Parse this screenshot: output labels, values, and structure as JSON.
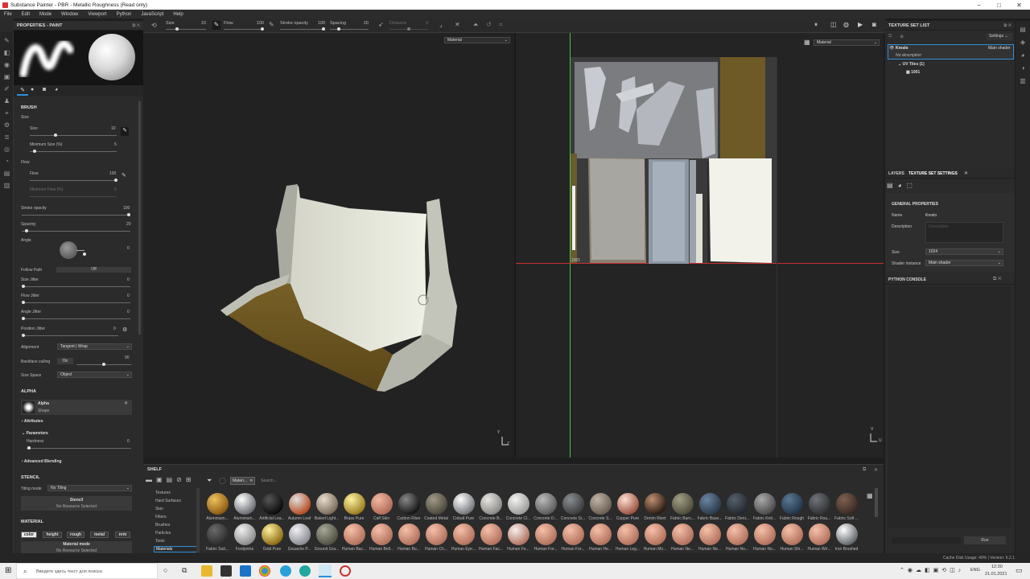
{
  "window": {
    "title": "Substance Painter - PBR - Metallic Roughness (Read only)",
    "controls": [
      "−",
      "□",
      "✕"
    ]
  },
  "menu": [
    "File",
    "Edit",
    "Mode",
    "Window",
    "Viewport",
    "Python",
    "JavaScript",
    "Help"
  ],
  "toolbar": {
    "size": {
      "label": "Size",
      "value": "10",
      "fraction": 0.25
    },
    "flow": {
      "label": "Flow",
      "value": "100",
      "fraction": 1.0
    },
    "stroke_opacity": {
      "label": "Stroke opacity",
      "value": "100",
      "fraction": 1.0
    },
    "spacing": {
      "label": "Spacing",
      "value": "20",
      "fraction": 0.2
    },
    "distance": {
      "label": "Distance",
      "value": "0"
    },
    "view_mode_3d": "Material",
    "view_mode_2d": "Material"
  },
  "properties": {
    "title": "PROPERTIES - PAINT",
    "brush_section": "BRUSH",
    "size_group": "Size",
    "size_label": "Size",
    "size_value": "10",
    "min_size_label": "Minimum Size (%)",
    "min_size_value": "5",
    "flow_group": "Flow",
    "flow_label": "Flow",
    "flow_value": "100",
    "min_flow_label": "Minimum Flow (%)",
    "min_flow_value": "5",
    "stroke_opacity_label": "Stroke opacity",
    "stroke_opacity_value": "100",
    "spacing_label": "Spacing",
    "spacing_value": "20",
    "angle_label": "Angle",
    "angle_value": "0",
    "follow_path_label": "Follow Path",
    "follow_path_value": "Off",
    "size_jitter_label": "Size Jitter",
    "size_jitter_value": "0",
    "flow_jitter_label": "Flow Jitter",
    "flow_jitter_value": "0",
    "angle_jitter_label": "Angle Jitter",
    "angle_jitter_value": "0",
    "position_jitter_label": "Position Jitter",
    "position_jitter_value": "0",
    "alignment_label": "Alignment",
    "alignment_value": "Tangent | Wrap",
    "backface_label": "Backface culling",
    "backface_toggle": "On",
    "backface_value": "90",
    "size_space_label": "Size Space",
    "size_space_value": "Object",
    "alpha_section": "ALPHA",
    "alpha_name": "Alpha",
    "alpha_type": "Shape",
    "attributes_label": "Attributes",
    "parameters_label": "Parameters",
    "hardness_label": "Hardness",
    "hardness_value": "0",
    "advanced_label": "Advanced Blending",
    "stencil_section": "STENCIL",
    "tiling_label": "Tiling mode",
    "tiling_value": "No Tiling",
    "stencil_name": "Stencil",
    "stencil_res": "No Resource Selected",
    "material_section": "MATERIAL",
    "channels": [
      "color",
      "height",
      "rough",
      "metal",
      "nrm"
    ],
    "material_mode": "Material mode",
    "material_res": "No Resource Selected"
  },
  "viewport": {
    "uv_label_top_left": "1001",
    "uv_label_bottom_left": "1001",
    "axis_3d": [
      "Y",
      "Z"
    ],
    "axis_2d": [
      "V",
      "U"
    ]
  },
  "shelf": {
    "title": "SHELF",
    "filter_tag": "Materi...",
    "search_placeholder": "Search...",
    "categories": [
      "Textures",
      "Hard Surfaces",
      "Skin",
      "Filters",
      "Brushes",
      "Particles",
      "Tools",
      "Materials"
    ],
    "active_category": "Materials",
    "row1": [
      {
        "name": "Aluminium...",
        "c1": "#f0c060",
        "c2": "#8a5a10"
      },
      {
        "name": "Aluminium...",
        "c1": "#ffffff",
        "c2": "#666a70"
      },
      {
        "name": "Artificial Lea...",
        "c1": "#555555",
        "c2": "#0a0a0a"
      },
      {
        "name": "Autumn Leaf",
        "c1": "#e0e0e0",
        "c2": "#b84a20"
      },
      {
        "name": "Baked Light...",
        "c1": "#e8dccc",
        "c2": "#7a6a5a"
      },
      {
        "name": "Brass Pure",
        "c1": "#fff4a0",
        "c2": "#9a7a20"
      },
      {
        "name": "Calf Skin",
        "c1": "#f2b8a0",
        "c2": "#b06a58"
      },
      {
        "name": "Carbon Fiber",
        "c1": "#888888",
        "c2": "#141414"
      },
      {
        "name": "Coated Metal",
        "c1": "#a09a86",
        "c2": "#4a463a"
      },
      {
        "name": "Cobalt Pure",
        "c1": "#ffffff",
        "c2": "#707378"
      },
      {
        "name": "Concrete B...",
        "c1": "#e8e6e2",
        "c2": "#8a8884"
      },
      {
        "name": "Concrete Cl...",
        "c1": "#f4f4f2",
        "c2": "#9a9a98"
      },
      {
        "name": "Concrete D...",
        "c1": "#bbbbbb",
        "c2": "#5a5a5a"
      },
      {
        "name": "Concrete Si...",
        "c1": "#8a8e90",
        "c2": "#3a3c3e"
      },
      {
        "name": "Concrete S...",
        "c1": "#c0b4a8",
        "c2": "#6a5e54"
      },
      {
        "name": "Copper Pure",
        "c1": "#ffe0d0",
        "c2": "#9a5040"
      },
      {
        "name": "Denim Rivet",
        "c1": "#c09070",
        "c2": "#2a1a12"
      },
      {
        "name": "Fabric Barn...",
        "c1": "#a4a084",
        "c2": "#4c4a3a"
      },
      {
        "name": "Fabric Base...",
        "c1": "#6a86a0",
        "c2": "#2a3a4a"
      },
      {
        "name": "Fabric Deni...",
        "c1": "#56606a",
        "c2": "#22282e"
      },
      {
        "name": "Fabric Knit...",
        "c1": "#aaaaaa",
        "c2": "#4a4a4a"
      },
      {
        "name": "Fabric Rough",
        "c1": "#5a7896",
        "c2": "#223446"
      },
      {
        "name": "Fabric Rou...",
        "c1": "#707478",
        "c2": "#2e3034"
      },
      {
        "name": "Fabric Soft ...",
        "c1": "#806050",
        "c2": "#3a2a22"
      }
    ],
    "row2": [
      {
        "name": "Fabric Suit...",
        "c1": "#6a6a6a",
        "c2": "#2a2a2a"
      },
      {
        "name": "Footprints",
        "c1": "#f0f0f0",
        "c2": "#8a8a8a"
      },
      {
        "name": "Gold Pure",
        "c1": "#fff0a0",
        "c2": "#8a6a10"
      },
      {
        "name": "Gouache P...",
        "c1": "#f0f0f4",
        "c2": "#8a8a94"
      },
      {
        "name": "Ground Gra...",
        "c1": "#a8a898",
        "c2": "#4e4e42"
      },
      {
        "name": "Human Bac...",
        "c1": "#f6c0a8",
        "c2": "#b0705c"
      },
      {
        "name": "Human Bell...",
        "c1": "#f6c0a8",
        "c2": "#b0705c"
      },
      {
        "name": "Human Bu...",
        "c1": "#f6c0a8",
        "c2": "#b0705c"
      },
      {
        "name": "Human Ch...",
        "c1": "#f6c0a8",
        "c2": "#b0705c"
      },
      {
        "name": "Human Eye...",
        "c1": "#f6c0a8",
        "c2": "#b0705c"
      },
      {
        "name": "Human Fac...",
        "c1": "#f6c0a8",
        "c2": "#b0705c"
      },
      {
        "name": "Human Fe...",
        "c1": "#f8f0ec",
        "c2": "#b07060"
      },
      {
        "name": "Human For...",
        "c1": "#f6c0a8",
        "c2": "#b0705c"
      },
      {
        "name": "Human For...",
        "c1": "#f6c0a8",
        "c2": "#b0705c"
      },
      {
        "name": "Human He...",
        "c1": "#f6c0a8",
        "c2": "#b0705c"
      },
      {
        "name": "Human Leg...",
        "c1": "#f6c0a8",
        "c2": "#b0705c"
      },
      {
        "name": "Human Mo...",
        "c1": "#f6c0a8",
        "c2": "#b0705c"
      },
      {
        "name": "Human Ne...",
        "c1": "#f6c0a8",
        "c2": "#b0705c"
      },
      {
        "name": "Human Ne...",
        "c1": "#f6c0a8",
        "c2": "#b0705c"
      },
      {
        "name": "Human No...",
        "c1": "#f6c0a8",
        "c2": "#b0705c"
      },
      {
        "name": "Human No...",
        "c1": "#f6c0a8",
        "c2": "#b0705c"
      },
      {
        "name": "Human Shi...",
        "c1": "#f6c0a8",
        "c2": "#b0705c"
      },
      {
        "name": "Human Wri...",
        "c1": "#f6c0a8",
        "c2": "#b0705c"
      },
      {
        "name": "Iron Brushed",
        "c1": "#ffffff",
        "c2": "#606468"
      }
    ]
  },
  "texture_set_list": {
    "title": "TEXTURE SET LIST",
    "settings": "Settings",
    "set_name": "Kreslo",
    "shader": "Main shader",
    "description": "No description",
    "uv_tiles": "UV Tiles (1)",
    "tile": "1001"
  },
  "tabs": {
    "layers": "LAYERS",
    "texture_set_settings": "TEXTURE SET SETTINGS"
  },
  "texture_set_settings": {
    "general": "GENERAL PROPERTIES",
    "name_label": "Name",
    "name_value": "Kreslo",
    "description_label": "Description",
    "description_placeholder": "Description",
    "size_label": "Size",
    "size_value": "1024",
    "shader_label": "Shader Instance",
    "shader_value": "Main shader"
  },
  "python_console": {
    "title": "PYTHON CONSOLE",
    "run": "Run"
  },
  "status": {
    "text": "Cache Disk Usage:  49% | Version: 6.2.1"
  },
  "taskbar": {
    "search_placeholder": "Введите здесь текст для поиска",
    "lang": "ENG",
    "time": "12:30",
    "date": "21.01.2021"
  },
  "colors": {
    "accent": "#2f8fd8",
    "uv_green": "#3cc83c",
    "uv_red": "#c83030"
  }
}
